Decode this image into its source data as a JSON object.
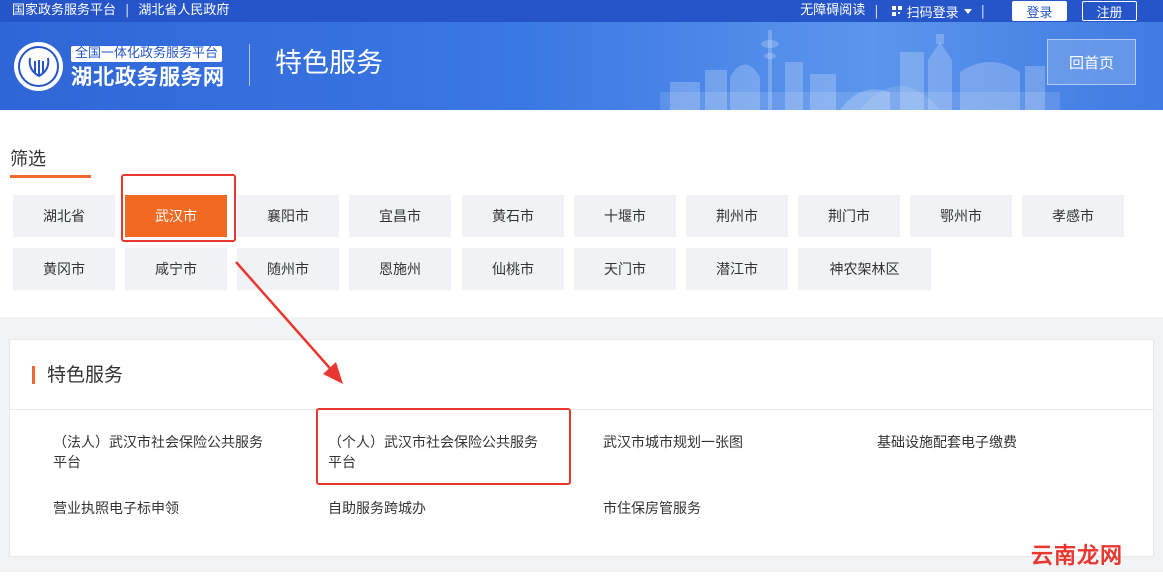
{
  "topbar": {
    "left_links": [
      "国家政务服务平台",
      "湖北省人民政府"
    ],
    "accessible": "无障碍阅读",
    "scan_login": "扫码登录",
    "login": "登录",
    "register": "注册"
  },
  "header": {
    "logo_sub": "全国一体化政务服务平台",
    "logo_main": "湖北政务服务网",
    "title": "特色服务",
    "home_button": "回首页"
  },
  "filter": {
    "title": "筛选",
    "selected": "武汉市",
    "cities": [
      "湖北省",
      "武汉市",
      "襄阳市",
      "宜昌市",
      "黄石市",
      "十堰市",
      "荆州市",
      "荆门市",
      "鄂州市",
      "孝感市",
      "黄冈市",
      "咸宁市",
      "随州市",
      "恩施州",
      "仙桃市",
      "天门市",
      "潜江市",
      "神农架林区"
    ]
  },
  "services": {
    "title": "特色服务",
    "items": [
      [
        "（法人）武汉市社会保险公共服务",
        "平台"
      ],
      [
        "（个人）武汉市社会保险公共服务",
        "平台"
      ],
      [
        "武汉市城市规划一张图"
      ],
      [
        "基础设施配套电子缴费"
      ],
      [
        "营业执照电子标申领"
      ],
      [
        "自助服务跨城办"
      ],
      [
        "市住保房管服务"
      ]
    ]
  },
  "watermark": "云南龙网",
  "colors": {
    "primary": "#2555c8",
    "accent": "#f26a21",
    "highlight": "#e8372f"
  }
}
